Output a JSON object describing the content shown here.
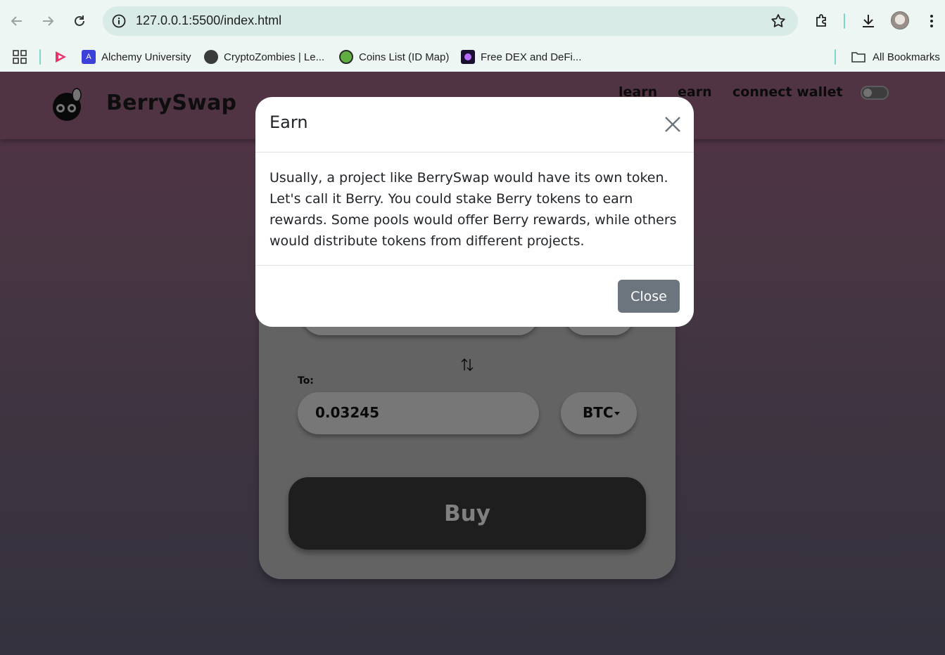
{
  "browser": {
    "url_host": "127.0.0.1",
    "url_path": ":5500/index.html",
    "bookmarks": [
      {
        "label": "Alchemy University",
        "icon": "alchemy-icon"
      },
      {
        "label": "CryptoZombies | Le...",
        "icon": "globe-icon"
      },
      {
        "label": "Coins List (ID Map)",
        "icon": "coingecko-icon"
      },
      {
        "label": "Free DEX and DeFi...",
        "icon": "dex-icon"
      }
    ],
    "all_bookmarks": "All Bookmarks"
  },
  "site": {
    "brand": "BerrySwap",
    "nav": [
      "learn",
      "earn",
      "connect wallet"
    ]
  },
  "swap": {
    "to_label": "To:",
    "to_amount": "0.03245",
    "to_token": "BTC",
    "buy_label": "Buy"
  },
  "modal": {
    "title": "Earn",
    "body": "Usually, a project like BerrySwap would have its own token. Let's call it Berry. You could stake Berry tokens to earn rewards. Some pools would offer Berry rewards, while others would distribute tokens from different projects.",
    "close_label": "Close"
  },
  "colors": {
    "header": "#94607c",
    "close_button": "#6c757d",
    "buy_button": "#373737"
  }
}
